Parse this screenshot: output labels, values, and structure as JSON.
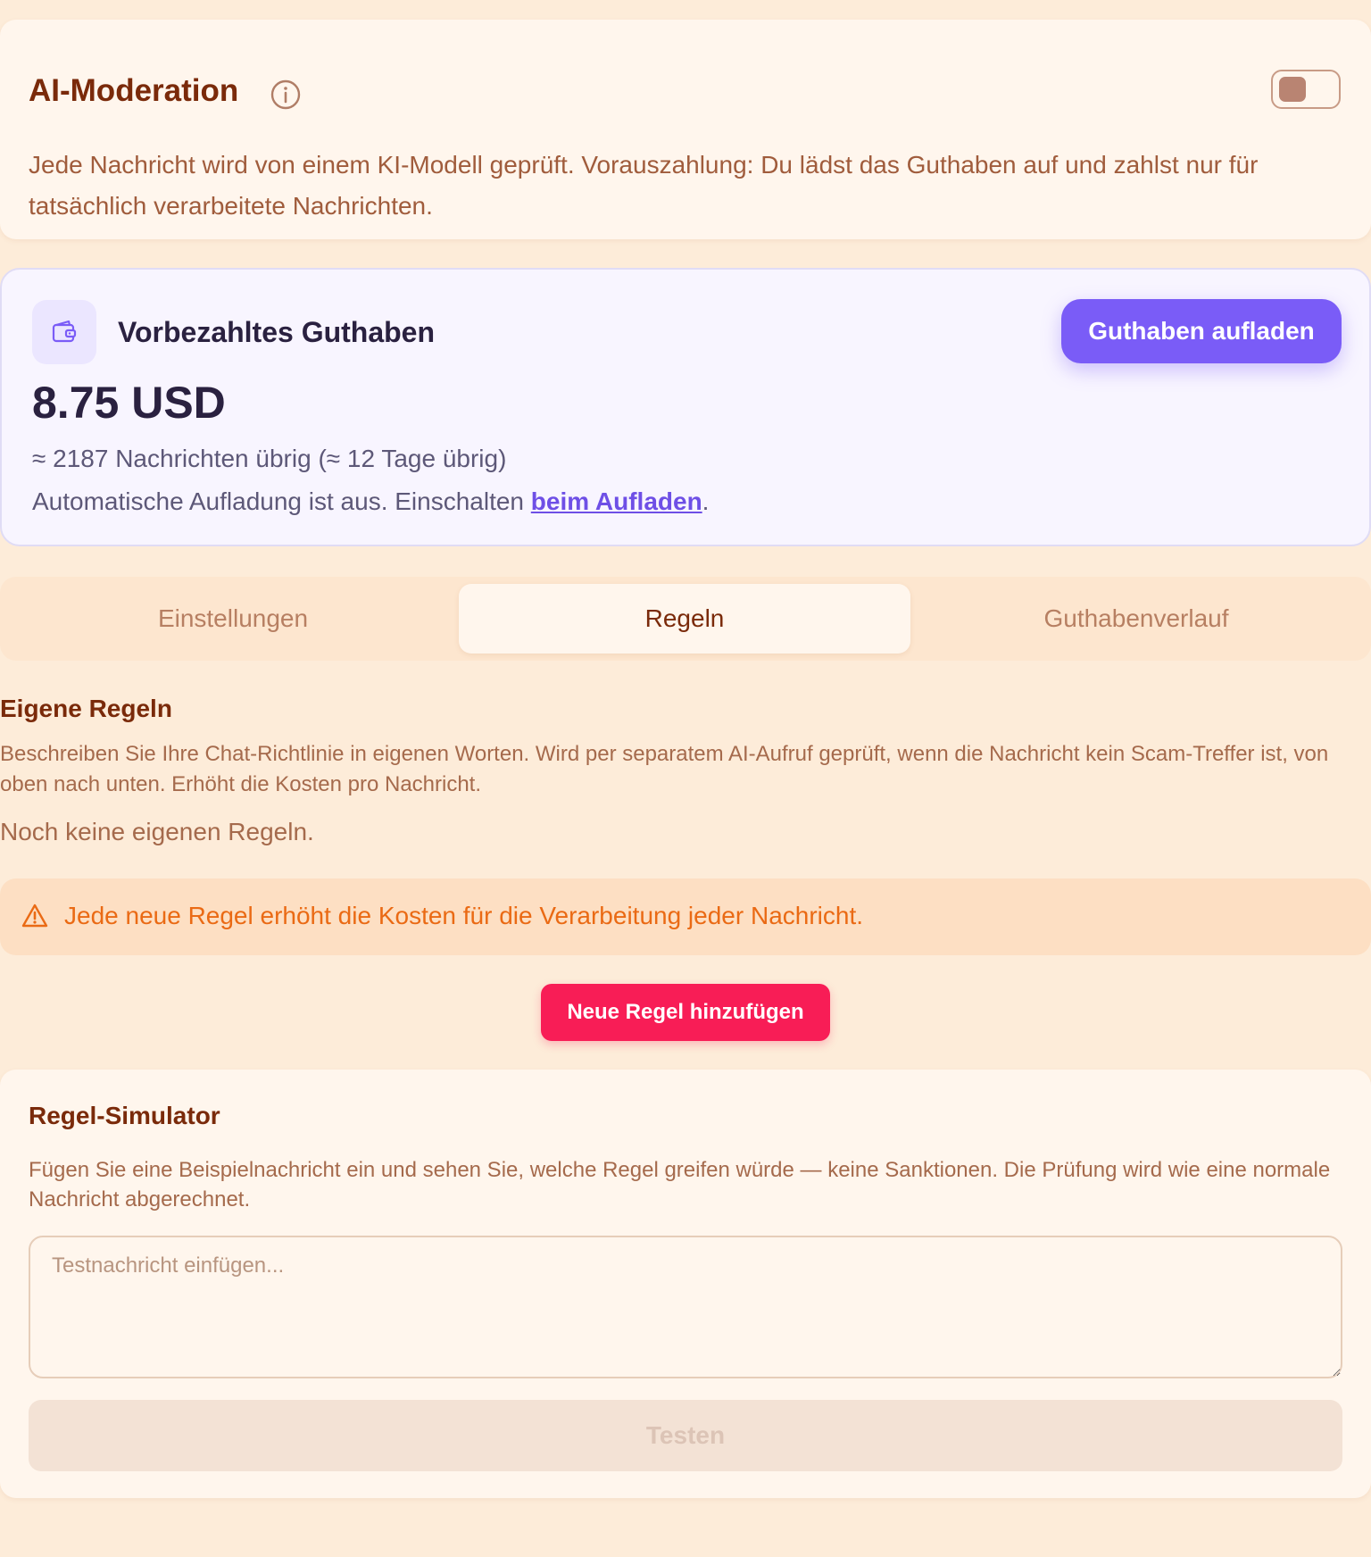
{
  "header": {
    "title": "AI-Moderation",
    "info_icon": "info-icon",
    "toggle_on": false,
    "description": "Jede Nachricht wird von einem KI-Modell geprüft. Vorauszahlung: Du lädst das Guthaben auf und zahlst nur für tatsächlich verarbeitete Nachrichten."
  },
  "balance": {
    "icon": "wallet-icon",
    "title": "Vorbezahltes Guthaben",
    "topup_label": "Guthaben aufladen",
    "amount": "8.75 USD",
    "remaining": "≈ 2187 Nachrichten übrig (≈ 12 Tage übrig)",
    "autotopup_text": "Automatische Aufladung ist aus. Einschalten ",
    "autotopup_link": "beim Aufladen",
    "autotopup_end": "."
  },
  "tabs": [
    {
      "label": "Einstellungen",
      "active": false
    },
    {
      "label": "Regeln",
      "active": true
    },
    {
      "label": "Guthabenverlauf",
      "active": false
    }
  ],
  "rules": {
    "heading": "Eigene Regeln",
    "description": "Beschreiben Sie Ihre Chat-Richtlinie in eigenen Worten. Wird per separatem AI-Aufruf geprüft, wenn die Nachricht kein Scam-Treffer ist, von oben nach unten. Erhöht die Kosten pro Nachricht.",
    "empty_text": "Noch keine eigenen Regeln.",
    "warning_icon": "warning-icon",
    "warning": "Jede neue Regel erhöht die Kosten für die Verarbeitung jeder Nachricht.",
    "add_label": "Neue Regel hinzufügen"
  },
  "simulator": {
    "title": "Regel-Simulator",
    "description": "Fügen Sie eine Beispielnachricht ein und sehen Sie, welche Regel greifen würde — keine Sanktionen. Die Prüfung wird wie eine normale Nachricht abgerechnet.",
    "input_value": "",
    "placeholder": "Testnachricht einfügen...",
    "test_label": "Testen"
  },
  "colors": {
    "accent_purple": "#7a5cf7",
    "accent_red": "#f81d56",
    "warning_orange": "#ea6a14",
    "background": "#fdecd9"
  }
}
